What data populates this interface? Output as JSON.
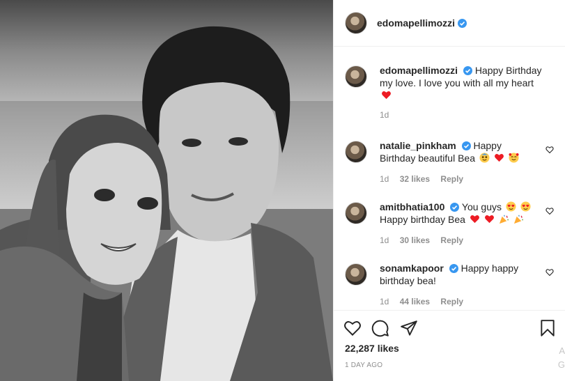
{
  "post": {
    "author": "edomapellimozzi",
    "likes": "22,287 likes",
    "time_ago": "1 DAY AGO"
  },
  "caption": {
    "user": "edomapellimozzi",
    "text_line1": "Happy Birthday",
    "text_line2": "my love. I love you with all my heart",
    "time": "1d"
  },
  "comments": [
    {
      "user": "natalie_pinkham",
      "text1": "Happy",
      "text2": "Birthday beautiful Bea",
      "time": "1d",
      "likes": "32 likes",
      "reply": "Reply"
    },
    {
      "user": "amitbhatia100",
      "text1": "You guys",
      "text2": "Happy birthday Bea",
      "time": "1d",
      "likes": "30 likes",
      "reply": "Reply"
    },
    {
      "user": "sonamkapoor",
      "text1": "Happy happy",
      "text2": "birthday bea!",
      "time": "1d",
      "likes": "44 likes",
      "reply": "Reply"
    }
  ],
  "edge_text": {
    "a": "A",
    "g": "G"
  },
  "colors": {
    "verified": "#3897f0",
    "heart": "#ed4956",
    "muted": "#8e8e8e"
  },
  "icons": [
    "like-icon",
    "comment-icon",
    "share-icon",
    "save-icon",
    "verified-icon",
    "heart-emoji",
    "small-heart-icon"
  ]
}
